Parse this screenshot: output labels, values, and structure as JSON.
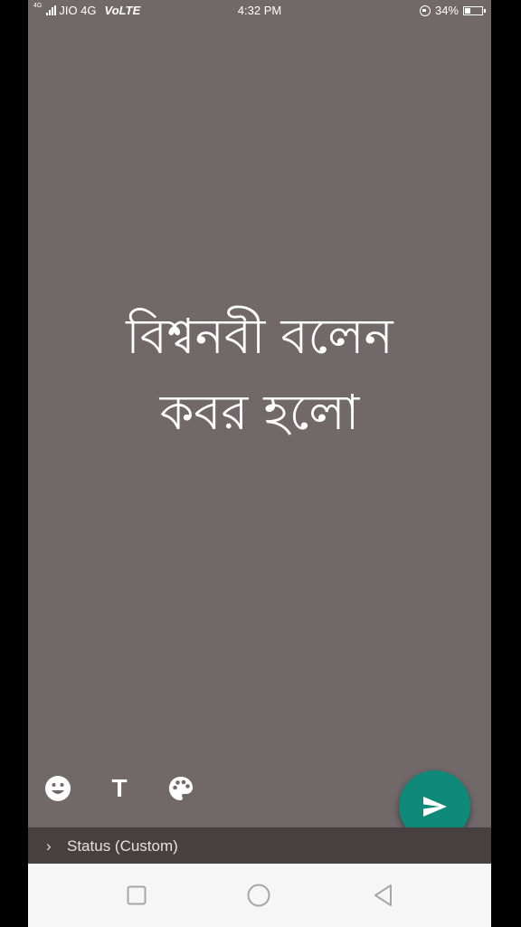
{
  "status_bar": {
    "network_tiny": "4G",
    "carrier": "JIO 4G",
    "volte": "VoLTE",
    "time": "4:32 PM",
    "battery_percent": "34%",
    "battery_level": 0.34
  },
  "status_editor": {
    "background_color": "#716869",
    "text": "বিশ্বনবী বলেন\nকবর হলো",
    "tools": [
      {
        "name": "emoji",
        "icon": "smiley-icon"
      },
      {
        "name": "text",
        "icon": "text-icon",
        "glyph": "T"
      },
      {
        "name": "color",
        "icon": "palette-icon"
      }
    ],
    "send_button_color": "#0f8a7a"
  },
  "caption_bar": {
    "chevron": "›",
    "audience_label": "Status (Custom)"
  },
  "nav_bar": {
    "buttons": [
      "recents-icon",
      "home-icon",
      "back-icon"
    ]
  }
}
